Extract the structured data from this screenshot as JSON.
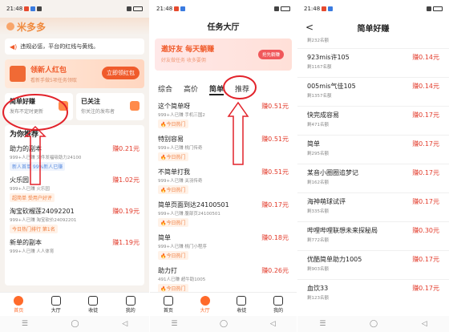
{
  "status_time": "21:48",
  "panel1": {
    "app_name": "米多多",
    "notice": "违规必惩，平台的红线与黄线。",
    "redpack": {
      "title": "领新人红包",
      "sub": "看新手做5项任务领取",
      "button": "立即领红包"
    },
    "card1": {
      "title": "简单好赚",
      "sub": "发布不定时更新"
    },
    "card2": {
      "title": "已关注",
      "sub": "你关注的发布者"
    },
    "rec_title": "为你推荐",
    "items": [
      {
        "title": "助力的副本",
        "price": "赚0.21元",
        "meta": "999+人已赚  文件发福吸助力24100",
        "tag": "新人首单 99%新人已赚",
        "tag_style": "blue"
      },
      {
        "title": "火乐园",
        "price": "赚1.02元",
        "meta": "999+人已赚  火乐园",
        "tag": "超简单 受用户好评",
        "tag_style": "orange"
      },
      {
        "title": "淘宝砍榴莲24092201",
        "price": "赚0.19元",
        "meta": "999+人已赚  淘宝砍价24092201",
        "tag": "今日热门排行 第1名",
        "tag_style": "orange"
      },
      {
        "title": "新单的副本",
        "price": "赚1.19元",
        "meta": "999+人已赚  人人体育",
        "tag": "",
        "tag_style": "orange"
      }
    ],
    "tabbar": [
      "首页",
      "大厅",
      "收徒",
      "我的"
    ],
    "active_tab": 0
  },
  "panel2": {
    "title": "任务大厅",
    "invite": {
      "title": "邀好友 每天躺赚",
      "sub": "好友做任务 收多要佣",
      "button": "抢先躺赚"
    },
    "tabs": [
      "综合",
      "高价",
      "简单",
      "推荐"
    ],
    "selected_tab": 2,
    "items": [
      {
        "title": "这个简单呀",
        "price": "赚0.51元",
        "meta": "999+人已赚  手机三国2",
        "tag": "今日热门"
      },
      {
        "title": "特别容易",
        "price": "赚0.51元",
        "meta": "999+人已赚  桃门传奇",
        "tag": "今日热门"
      },
      {
        "title": "不简单打我",
        "price": "赚0.51元",
        "meta": "999+人已赚  关羽传奇",
        "tag": "今日热门"
      },
      {
        "title": "简单页面到达24100501",
        "price": "赚0.17元",
        "meta": "999+人已赚  腹部页24100501",
        "tag": "今日热门"
      },
      {
        "title": "简单",
        "price": "赚0.18元",
        "meta": "999+人已赚  桃门小程序",
        "tag": "今日热门"
      },
      {
        "title": "助力打",
        "price": "赚0.26元",
        "meta": "491人已赚  超牛助1005",
        "tag": "今日热门"
      }
    ],
    "tabbar": [
      "首页",
      "大厅",
      "收徒",
      "我的"
    ],
    "active_tab": 1
  },
  "panel3": {
    "title": "简单好赚",
    "back": "<",
    "first_meta": "剩232名额",
    "items": [
      {
        "title": "923mis许105",
        "price": "赚0.14元",
        "meta": "剩1167名额"
      },
      {
        "title": "005mis气佳105",
        "price": "赚0.14元",
        "meta": "剩1357名额"
      },
      {
        "title": "快完成容易",
        "price": "赚0.17元",
        "meta": "剩471名额"
      },
      {
        "title": "简单",
        "price": "赚0.17元",
        "meta": "剩295名额"
      },
      {
        "title": "某音小圈圈追梦记",
        "price": "赚0.17元",
        "meta": "剩162名额"
      },
      {
        "title": "海神萌球试评",
        "price": "赚0.17元",
        "meta": "剩335名额"
      },
      {
        "title": "哔哩哔哩联想未来探秘局",
        "price": "赚0.30元",
        "meta": "剩772名额"
      },
      {
        "title": "优酷简单助力1005",
        "price": "赚0.17元",
        "meta": "剩903名额"
      },
      {
        "title": "血饮33",
        "price": "赚0.17元",
        "meta": "剩123名额"
      }
    ]
  },
  "sysnav": [
    "☰",
    "◯",
    "◁"
  ]
}
